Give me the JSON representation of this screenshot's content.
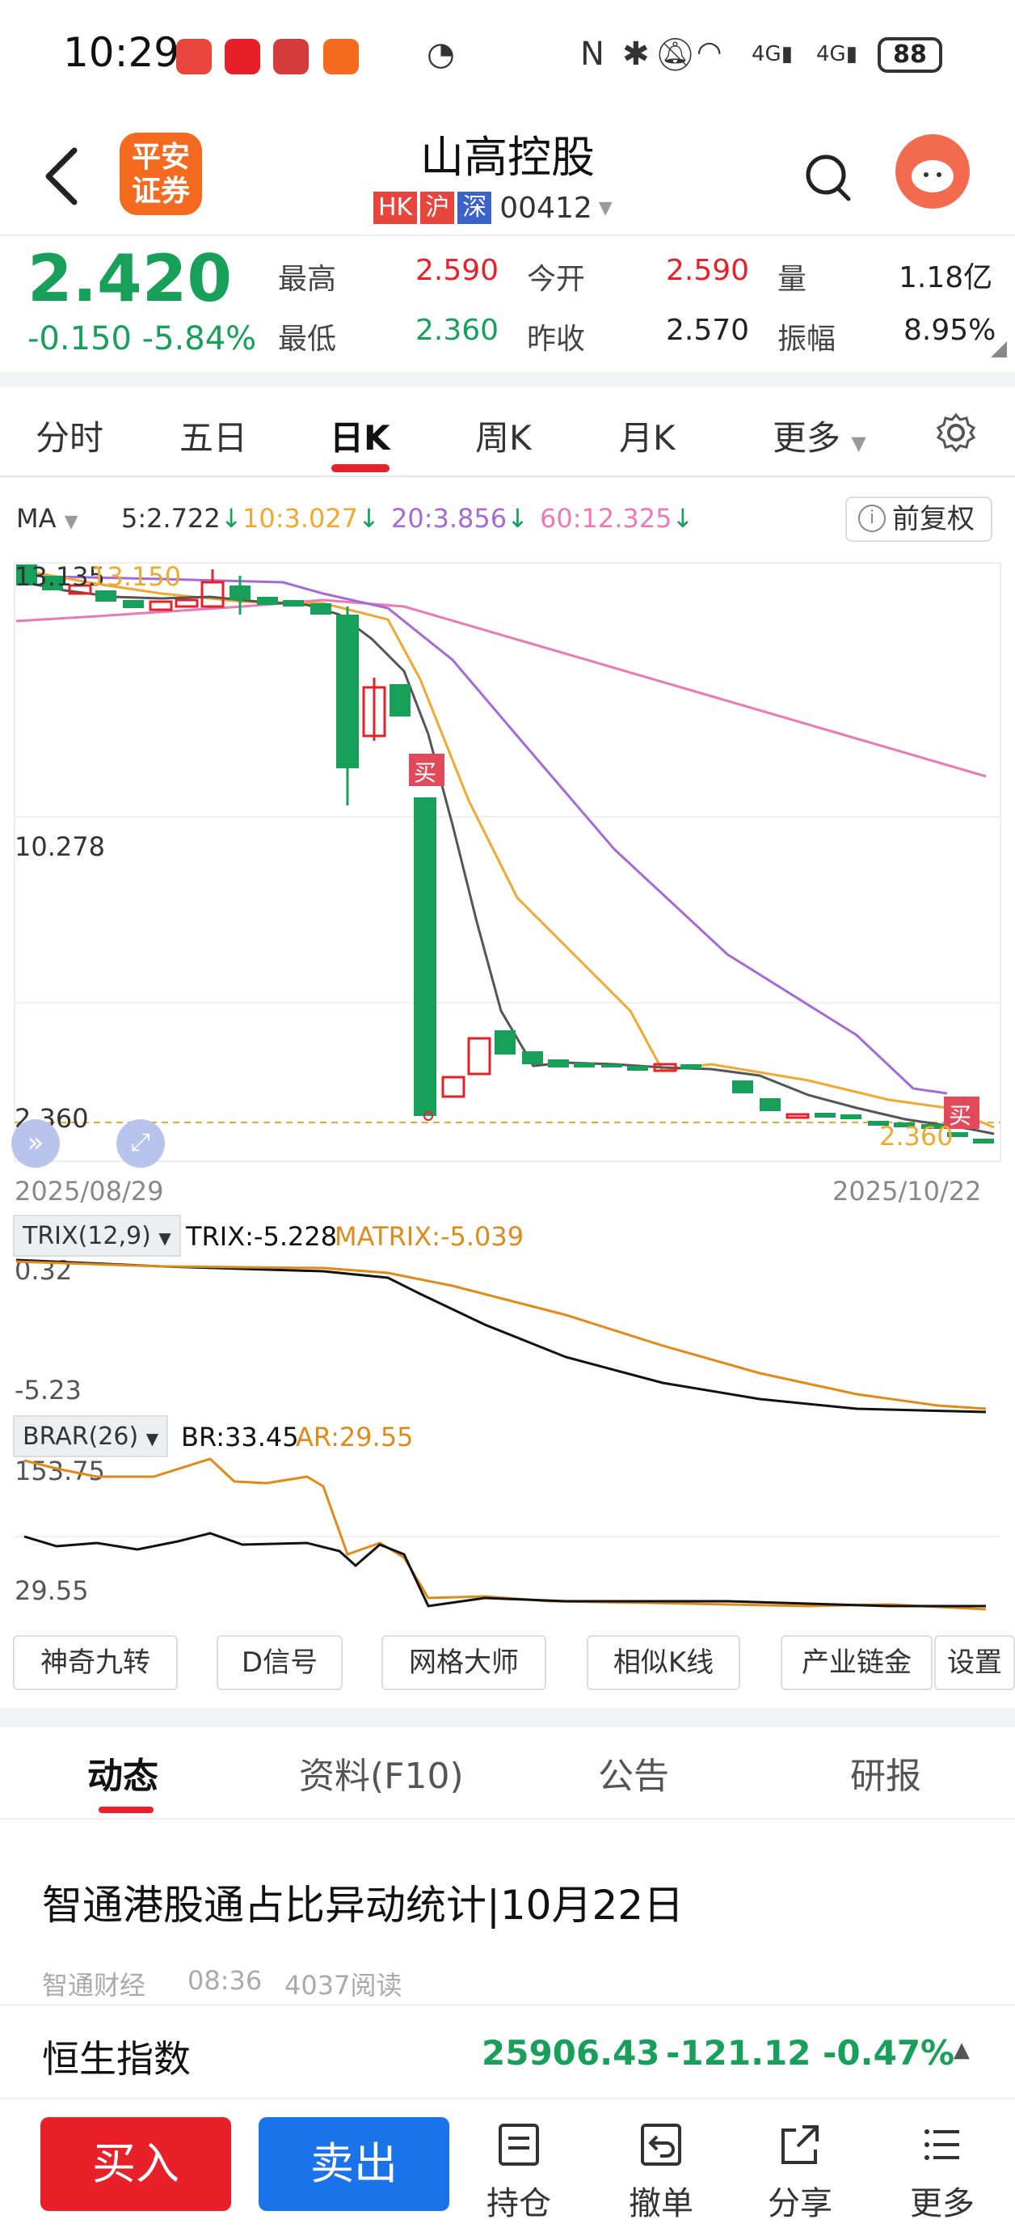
{
  "status": {
    "time": "10:29",
    "battery": "88"
  },
  "header": {
    "logo_line1": "平安",
    "logo_line2": "证券",
    "title": "山高控股",
    "tags": [
      "HK",
      "沪",
      "深"
    ],
    "code": "00412"
  },
  "quote": {
    "price": "2.420",
    "change": "-0.150",
    "change_pct": "-5.84%",
    "high_label": "最高",
    "high": "2.590",
    "open_label": "今开",
    "open": "2.590",
    "vol_label": "量",
    "vol": "1.18亿",
    "low_label": "最低",
    "low": "2.360",
    "prev_label": "昨收",
    "prev": "2.570",
    "amp_label": "振幅",
    "amp": "8.95%"
  },
  "tabs": [
    "分时",
    "五日",
    "日K",
    "周K",
    "月K",
    "更多"
  ],
  "ma": {
    "label": "MA",
    "ma5": "5:2.722",
    "ma10": "10:3.027",
    "ma20": "20:3.856",
    "ma60": "60:12.325",
    "fuquan": "前复权"
  },
  "chart": {
    "top_label": "13.135",
    "top_label2": "13.150",
    "mid_label": "10.278",
    "low_label": "2.360",
    "low_label2": "2.360",
    "date_start": "2025/08/29",
    "date_end": "2025/10/22",
    "buy_marker": "买"
  },
  "trix": {
    "tag": "TRIX(12,9)",
    "trix": "TRIX:-5.228",
    "matrix": "MATRIX:-5.039",
    "max": "0.32",
    "min": "-5.23"
  },
  "brar": {
    "tag": "BRAR(26)",
    "br": "BR:33.45",
    "ar": "AR:29.55",
    "max": "153.75",
    "min": "29.55"
  },
  "tools": [
    "神奇九转",
    "D信号",
    "网格大师",
    "相似K线",
    "产业链金",
    "设置"
  ],
  "news_tabs": [
    "动态",
    "资料(F10)",
    "公告",
    "研报"
  ],
  "news": {
    "title": "智通港股通占比异动统计|10月22日",
    "source": "智通财经",
    "time": "08:36",
    "reads": "4037阅读"
  },
  "index": {
    "name": "恒生指数",
    "value": "25906.43",
    "change": "-121.12",
    "pct": "-0.47%"
  },
  "bottom": {
    "buy": "买入",
    "sell": "卖出",
    "items": [
      "持仓",
      "撤单",
      "分享",
      "更多"
    ]
  },
  "colors": {
    "up": "#e8202a",
    "down": "#18a05a",
    "ma5": "#555555",
    "ma10": "#f0a830",
    "ma20": "#a66ad8",
    "ma60": "#e87ab8"
  }
}
